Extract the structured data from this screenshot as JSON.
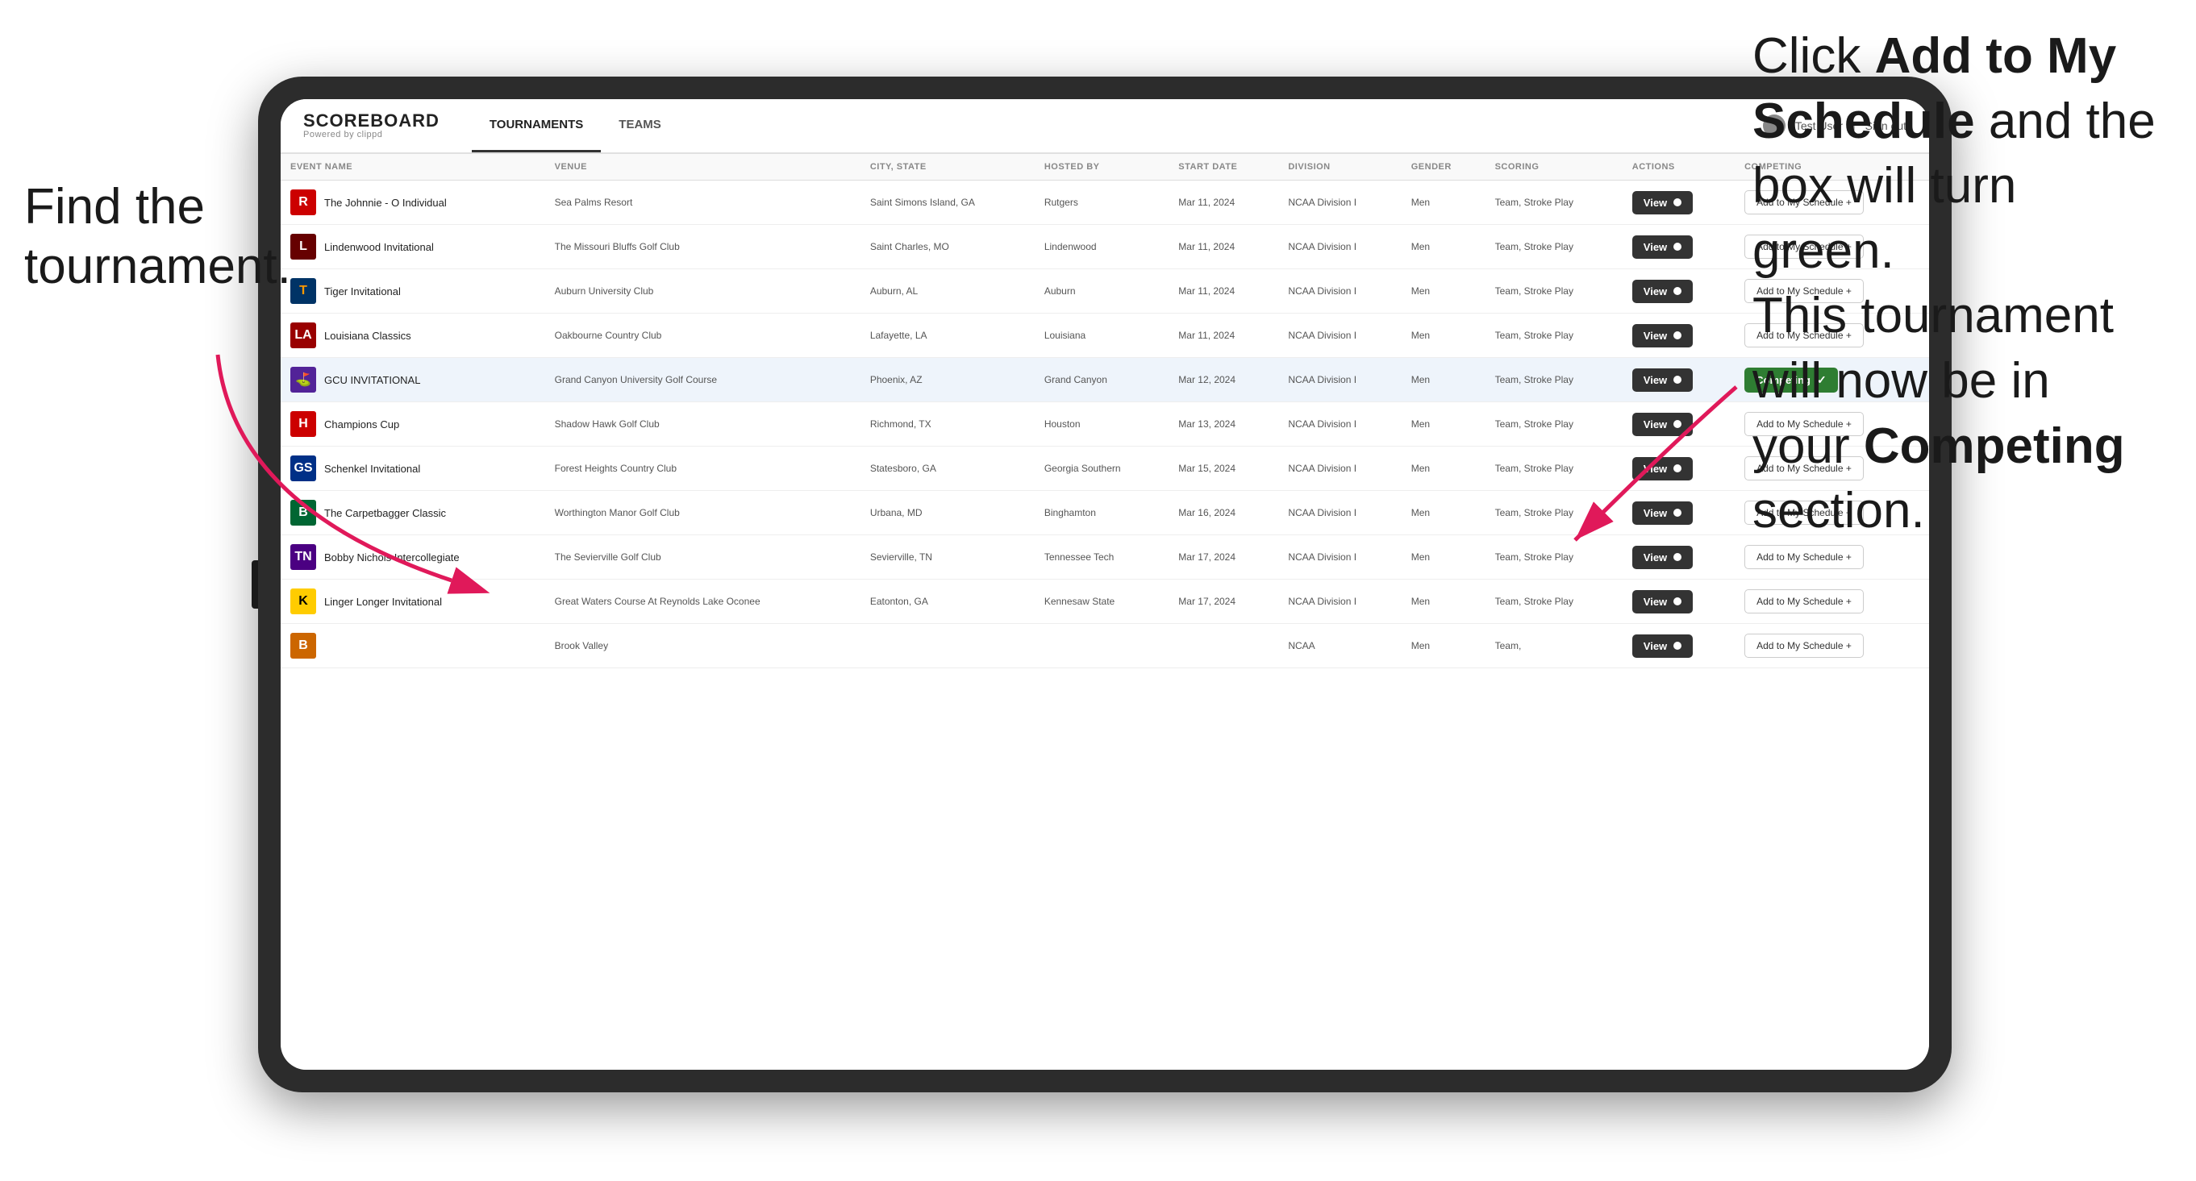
{
  "annotations": {
    "left": "Find the\ntournament.",
    "right_p1": "Click ",
    "right_bold1": "Add to My\nSchedule",
    "right_p2": " and the\nbox will turn green.\nThis tournament\nwill now be in\nyour ",
    "right_bold2": "Competing",
    "right_p3": "\nsection."
  },
  "app": {
    "logo_title": "SCOREBOARD",
    "logo_subtitle": "Powered by clippd",
    "nav_tabs": [
      {
        "label": "TOURNAMENTS",
        "active": true
      },
      {
        "label": "TEAMS",
        "active": false
      }
    ],
    "user_label": "Test User",
    "sign_out_label": "Sign out"
  },
  "table": {
    "columns": [
      "EVENT NAME",
      "VENUE",
      "CITY, STATE",
      "HOSTED BY",
      "START DATE",
      "DIVISION",
      "GENDER",
      "SCORING",
      "ACTIONS",
      "COMPETING"
    ],
    "rows": [
      {
        "logo_letter": "R",
        "logo_class": "logo-r",
        "event_name": "The Johnnie - O Individual",
        "venue": "Sea Palms Resort",
        "city_state": "Saint Simons Island, GA",
        "hosted_by": "Rutgers",
        "start_date": "Mar 11, 2024",
        "division": "NCAA Division I",
        "gender": "Men",
        "scoring": "Team, Stroke Play",
        "competing_status": "add",
        "add_label": "Add to My Schedule +"
      },
      {
        "logo_letter": "L",
        "logo_class": "logo-l",
        "event_name": "Lindenwood Invitational",
        "venue": "The Missouri Bluffs Golf Club",
        "city_state": "Saint Charles, MO",
        "hosted_by": "Lindenwood",
        "start_date": "Mar 11, 2024",
        "division": "NCAA Division I",
        "gender": "Men",
        "scoring": "Team, Stroke Play",
        "competing_status": "add",
        "add_label": "Add to My Schedule +"
      },
      {
        "logo_letter": "T",
        "logo_class": "logo-t",
        "event_name": "Tiger Invitational",
        "venue": "Auburn University Club",
        "city_state": "Auburn, AL",
        "hosted_by": "Auburn",
        "start_date": "Mar 11, 2024",
        "division": "NCAA Division I",
        "gender": "Men",
        "scoring": "Team, Stroke Play",
        "competing_status": "add",
        "add_label": "Add to My Schedule +"
      },
      {
        "logo_letter": "LA",
        "logo_class": "logo-la",
        "event_name": "Louisiana Classics",
        "venue": "Oakbourne Country Club",
        "city_state": "Lafayette, LA",
        "hosted_by": "Louisiana",
        "start_date": "Mar 11, 2024",
        "division": "NCAA Division I",
        "gender": "Men",
        "scoring": "Team, Stroke Play",
        "competing_status": "add",
        "add_label": "Add to My Schedule +"
      },
      {
        "logo_letter": "~",
        "logo_class": "logo-gcu",
        "event_name": "GCU INVITATIONAL",
        "venue": "Grand Canyon University Golf Course",
        "city_state": "Phoenix, AZ",
        "hosted_by": "Grand Canyon",
        "start_date": "Mar 12, 2024",
        "division": "NCAA Division I",
        "gender": "Men",
        "scoring": "Team, Stroke Play",
        "competing_status": "competing",
        "competing_label": "Competing",
        "check": "✓"
      },
      {
        "logo_letter": "H",
        "logo_class": "logo-h",
        "event_name": "Champions Cup",
        "venue": "Shadow Hawk Golf Club",
        "city_state": "Richmond, TX",
        "hosted_by": "Houston",
        "start_date": "Mar 13, 2024",
        "division": "NCAA Division I",
        "gender": "Men",
        "scoring": "Team, Stroke Play",
        "competing_status": "add",
        "add_label": "Add to My Schedule +"
      },
      {
        "logo_letter": "GS",
        "logo_class": "logo-gs",
        "event_name": "Schenkel Invitational",
        "venue": "Forest Heights Country Club",
        "city_state": "Statesboro, GA",
        "hosted_by": "Georgia Southern",
        "start_date": "Mar 15, 2024",
        "division": "NCAA Division I",
        "gender": "Men",
        "scoring": "Team, Stroke Play",
        "competing_status": "add",
        "add_label": "Add to My Schedule +"
      },
      {
        "logo_letter": "B",
        "logo_class": "logo-b",
        "event_name": "The Carpetbagger Classic",
        "venue": "Worthington Manor Golf Club",
        "city_state": "Urbana, MD",
        "hosted_by": "Binghamton",
        "start_date": "Mar 16, 2024",
        "division": "NCAA Division I",
        "gender": "Men",
        "scoring": "Team, Stroke Play",
        "competing_status": "add",
        "add_label": "Add to My Schedule +"
      },
      {
        "logo_letter": "TN",
        "logo_class": "logo-tn",
        "event_name": "Bobby Nichols Intercollegiate",
        "venue": "The Sevierville Golf Club",
        "city_state": "Sevierville, TN",
        "hosted_by": "Tennessee Tech",
        "start_date": "Mar 17, 2024",
        "division": "NCAA Division I",
        "gender": "Men",
        "scoring": "Team, Stroke Play",
        "competing_status": "add",
        "add_label": "Add to My Schedule +"
      },
      {
        "logo_letter": "K",
        "logo_class": "logo-k",
        "event_name": "Linger Longer Invitational",
        "venue": "Great Waters Course At Reynolds Lake Oconee",
        "city_state": "Eatonton, GA",
        "hosted_by": "Kennesaw State",
        "start_date": "Mar 17, 2024",
        "division": "NCAA Division I",
        "gender": "Men",
        "scoring": "Team, Stroke Play",
        "competing_status": "add",
        "add_label": "Add to My Schedule +"
      },
      {
        "logo_letter": "B",
        "logo_class": "logo-br",
        "event_name": "",
        "venue": "Brook Valley",
        "city_state": "",
        "hosted_by": "",
        "start_date": "",
        "division": "NCAA",
        "gender": "Men",
        "scoring": "Team,",
        "competing_status": "add",
        "add_label": "Add to My Schedule +"
      }
    ]
  }
}
